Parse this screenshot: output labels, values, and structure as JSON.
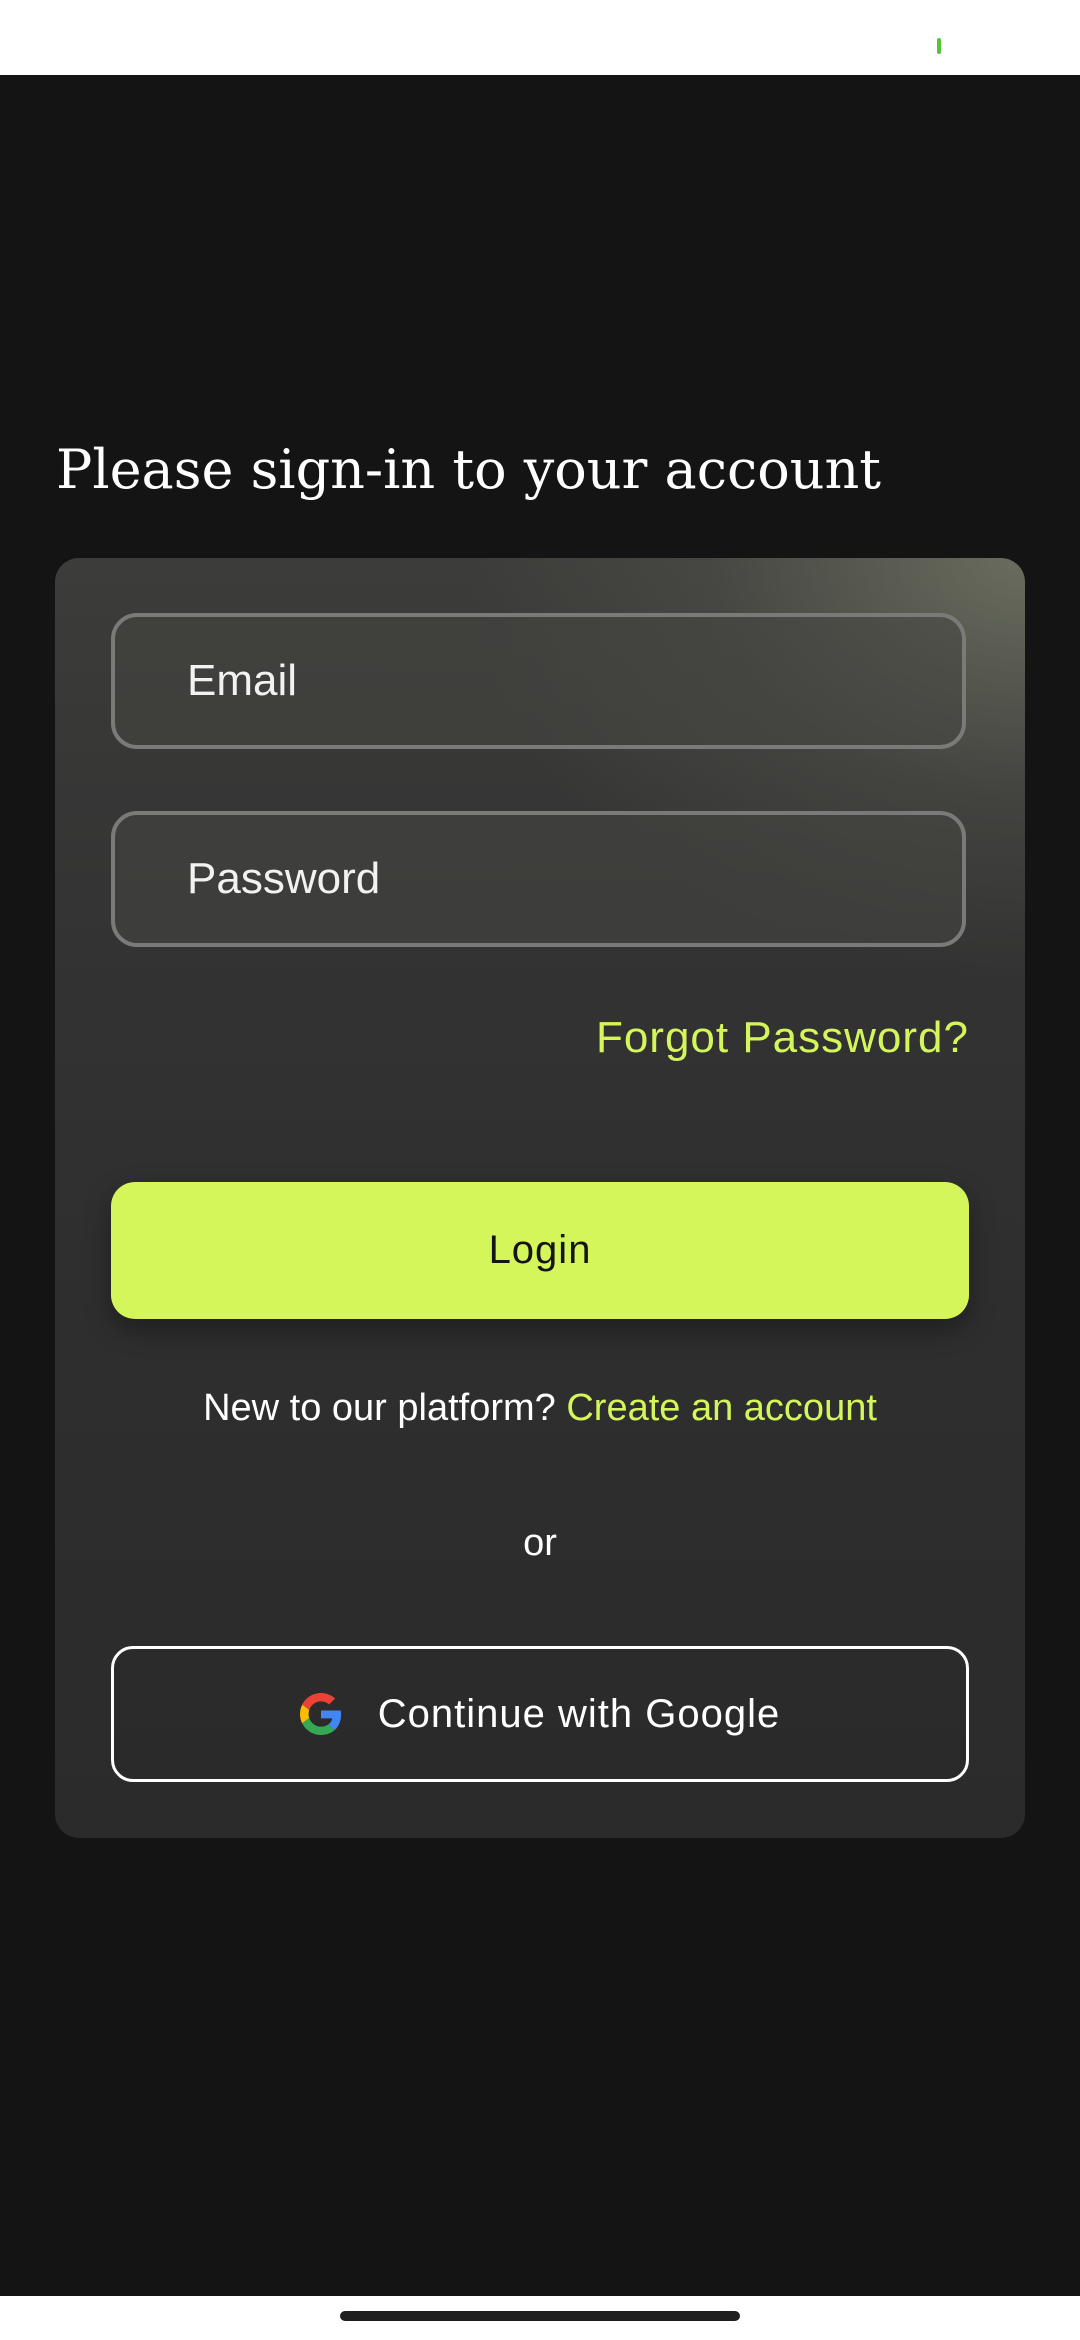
{
  "status_bar": {
    "indicator_color": "#5bc236"
  },
  "heading": "Please sign-in to your account",
  "form": {
    "email_placeholder": "Email",
    "password_placeholder": "Password",
    "forgot_password": "Forgot Password?",
    "login_label": "Login",
    "signup_prompt": "New to our platform? ",
    "signup_link": "Create an account",
    "divider_text": "or",
    "google_label": "Continue with Google",
    "google_icon": "google-g-icon"
  },
  "colors": {
    "background": "#141414",
    "accent": "#d4f65a",
    "card": "#333333",
    "text": "#ffffff"
  }
}
